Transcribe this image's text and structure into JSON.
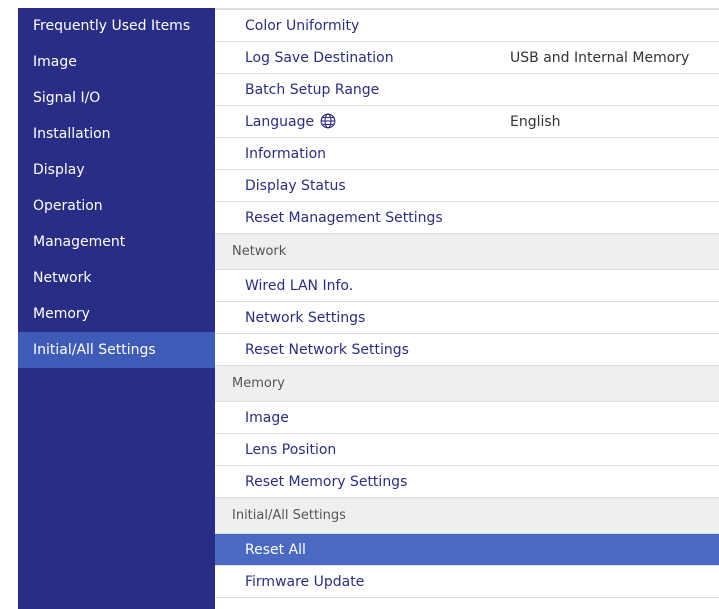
{
  "sidebar": {
    "items": [
      {
        "label": "Frequently Used Items"
      },
      {
        "label": "Image"
      },
      {
        "label": "Signal I/O"
      },
      {
        "label": "Installation"
      },
      {
        "label": "Display"
      },
      {
        "label": "Operation"
      },
      {
        "label": "Management"
      },
      {
        "label": "Network"
      },
      {
        "label": "Memory"
      },
      {
        "label": "Initial/All Settings",
        "selected": true
      }
    ]
  },
  "main": {
    "rows": [
      {
        "label": "Color Uniformity"
      },
      {
        "label": "Log Save Destination",
        "value": "USB and Internal Memory"
      },
      {
        "label": "Batch Setup Range"
      },
      {
        "label": "Language",
        "value": "English",
        "icon": "globe-icon"
      },
      {
        "label": "Information"
      },
      {
        "label": "Display Status"
      },
      {
        "label": "Reset Management Settings"
      },
      {
        "label": "Network",
        "header": true
      },
      {
        "label": "Wired LAN Info."
      },
      {
        "label": "Network Settings"
      },
      {
        "label": "Reset Network Settings"
      },
      {
        "label": "Memory",
        "header": true
      },
      {
        "label": "Image"
      },
      {
        "label": "Lens Position"
      },
      {
        "label": "Reset Memory Settings"
      },
      {
        "label": "Initial/All Settings",
        "header": true
      },
      {
        "label": "Reset All",
        "selected": true
      },
      {
        "label": "Firmware Update"
      }
    ]
  },
  "colors": {
    "sidebar_bg": "#2a2d86",
    "sidebar_selected": "#3f5bb8",
    "row_selected": "#4a6ac2",
    "item_text": "#2a2d86"
  }
}
